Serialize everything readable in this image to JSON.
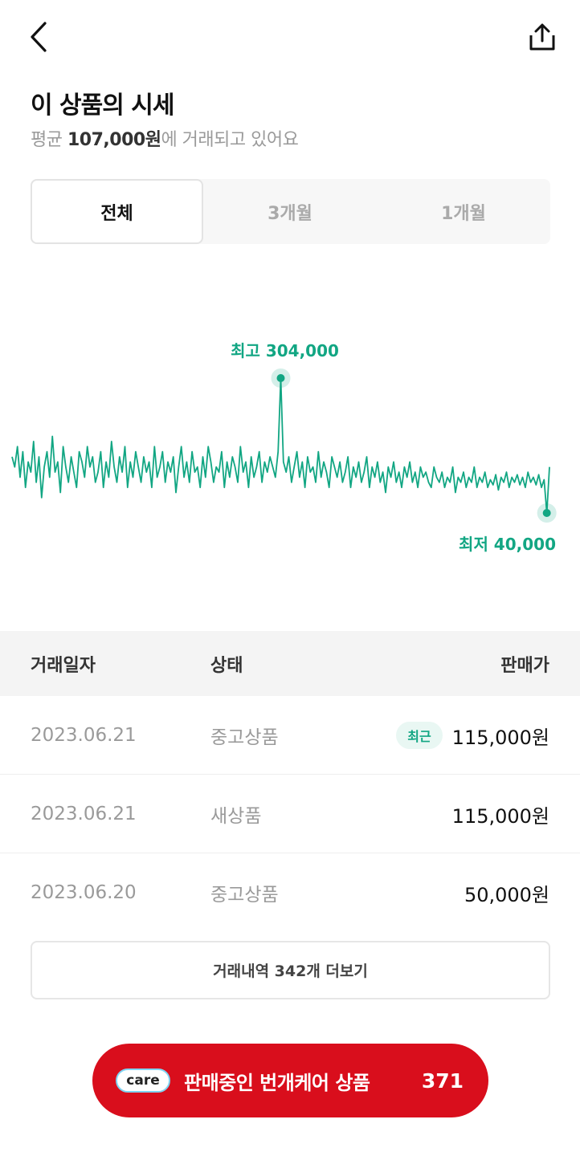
{
  "header": {
    "back_icon": "chevron-left-icon",
    "share_icon": "share-icon"
  },
  "summary": {
    "title": "이 상품의 시세",
    "avg_prefix": "평균 ",
    "avg_value": "107,000원",
    "avg_suffix": "에 거래되고 있어요"
  },
  "period_tabs": [
    {
      "label": "전체",
      "active": true
    },
    {
      "label": "3개월",
      "active": false
    },
    {
      "label": "1개월",
      "active": false
    }
  ],
  "chart_data": {
    "type": "line",
    "series": [
      {
        "values": [
          150,
          130,
          170,
          110,
          160,
          90,
          140,
          120,
          180,
          100,
          150,
          70,
          130,
          160,
          110,
          190,
          120,
          140,
          80,
          170,
          130,
          100,
          150,
          120,
          90,
          160,
          140,
          110,
          170,
          130,
          150,
          100,
          120,
          160,
          90,
          140,
          110,
          180,
          130,
          100,
          150,
          120,
          170,
          90,
          140,
          110,
          160,
          130,
          100,
          150,
          120,
          140,
          90,
          170,
          110,
          130,
          160,
          100,
          140,
          120,
          150,
          80,
          130,
          170,
          110,
          140,
          100,
          160,
          120,
          130,
          90,
          150,
          110,
          170,
          140,
          100,
          130,
          120,
          160,
          90,
          140,
          110,
          150,
          130,
          100,
          170,
          120,
          140,
          90,
          150,
          110,
          130,
          160,
          100,
          140,
          120,
          150,
          130,
          110,
          160,
          304,
          140,
          120,
          150,
          100,
          130,
          160,
          110,
          140,
          90,
          150,
          120,
          130,
          100,
          160,
          110,
          140,
          120,
          90,
          150,
          130,
          110,
          140,
          100,
          120,
          150,
          90,
          130,
          110,
          140,
          100,
          120,
          150,
          90,
          130,
          110,
          140,
          100,
          120,
          80,
          130,
          110,
          140,
          100,
          120,
          90,
          130,
          110,
          140,
          100,
          120,
          90,
          130,
          110,
          120,
          100,
          90,
          130,
          110,
          100,
          120,
          90,
          110,
          100,
          130,
          80,
          110,
          100,
          120,
          90,
          110,
          100,
          130,
          90,
          110,
          100,
          120,
          90,
          105,
          95,
          115,
          85,
          110,
          100,
          120,
          90,
          110,
          100,
          115,
          95,
          110,
          90,
          120,
          100,
          110,
          95,
          115,
          90,
          105,
          40,
          130
        ]
      }
    ],
    "y_unit": "원",
    "max_label": "최고 304,000",
    "min_label": "최저 40,000",
    "max_value": 304000,
    "min_value": 40000,
    "line_color": "#12a683"
  },
  "table": {
    "headers": [
      "거래일자",
      "상태",
      "판매가"
    ],
    "rows": [
      {
        "date": "2023.06.21",
        "state": "중고상품",
        "badge": "최근",
        "price": "115,000원"
      },
      {
        "date": "2023.06.21",
        "state": "새상품",
        "badge": "",
        "price": "115,000원"
      },
      {
        "date": "2023.06.20",
        "state": "중고상품",
        "badge": "",
        "price": "50,000원"
      }
    ]
  },
  "more_button": "거래내역 342개 더보기",
  "cta": {
    "logo": "care",
    "label": "판매중인 번개케어 상품",
    "count": "371",
    "color": "#d90e1c"
  }
}
